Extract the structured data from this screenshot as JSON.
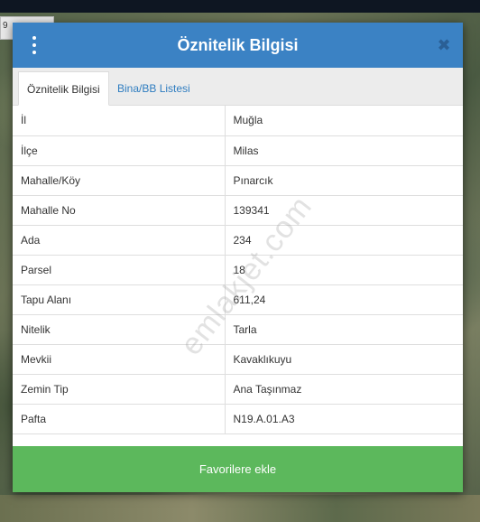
{
  "map": {
    "chip_text": "9"
  },
  "dialog": {
    "title": "Öznitelik Bilgisi",
    "close_glyph": "✖"
  },
  "tabs": [
    {
      "label": "Öznitelik Bilgisi",
      "active": true
    },
    {
      "label": "Bina/BB Listesi",
      "active": false
    }
  ],
  "attributes": [
    {
      "key": "İl",
      "value": "Muğla"
    },
    {
      "key": "İlçe",
      "value": "Milas"
    },
    {
      "key": "Mahalle/Köy",
      "value": "Pınarcık"
    },
    {
      "key": "Mahalle No",
      "value": "139341"
    },
    {
      "key": "Ada",
      "value": "234"
    },
    {
      "key": "Parsel",
      "value": "18"
    },
    {
      "key": "Tapu Alanı",
      "value": "611,24"
    },
    {
      "key": "Nitelik",
      "value": "Tarla"
    },
    {
      "key": "Mevkii",
      "value": "Kavaklıkuyu"
    },
    {
      "key": "Zemin Tip",
      "value": "Ana Taşınmaz"
    },
    {
      "key": "Pafta",
      "value": "N19.A.01.A3"
    }
  ],
  "favorite_button": {
    "label": "Favorilere ekle"
  },
  "watermark": "emlakjet.com",
  "colors": {
    "header": "#3b82c4",
    "tab_link": "#2f7dc0",
    "button": "#5cb85c"
  }
}
